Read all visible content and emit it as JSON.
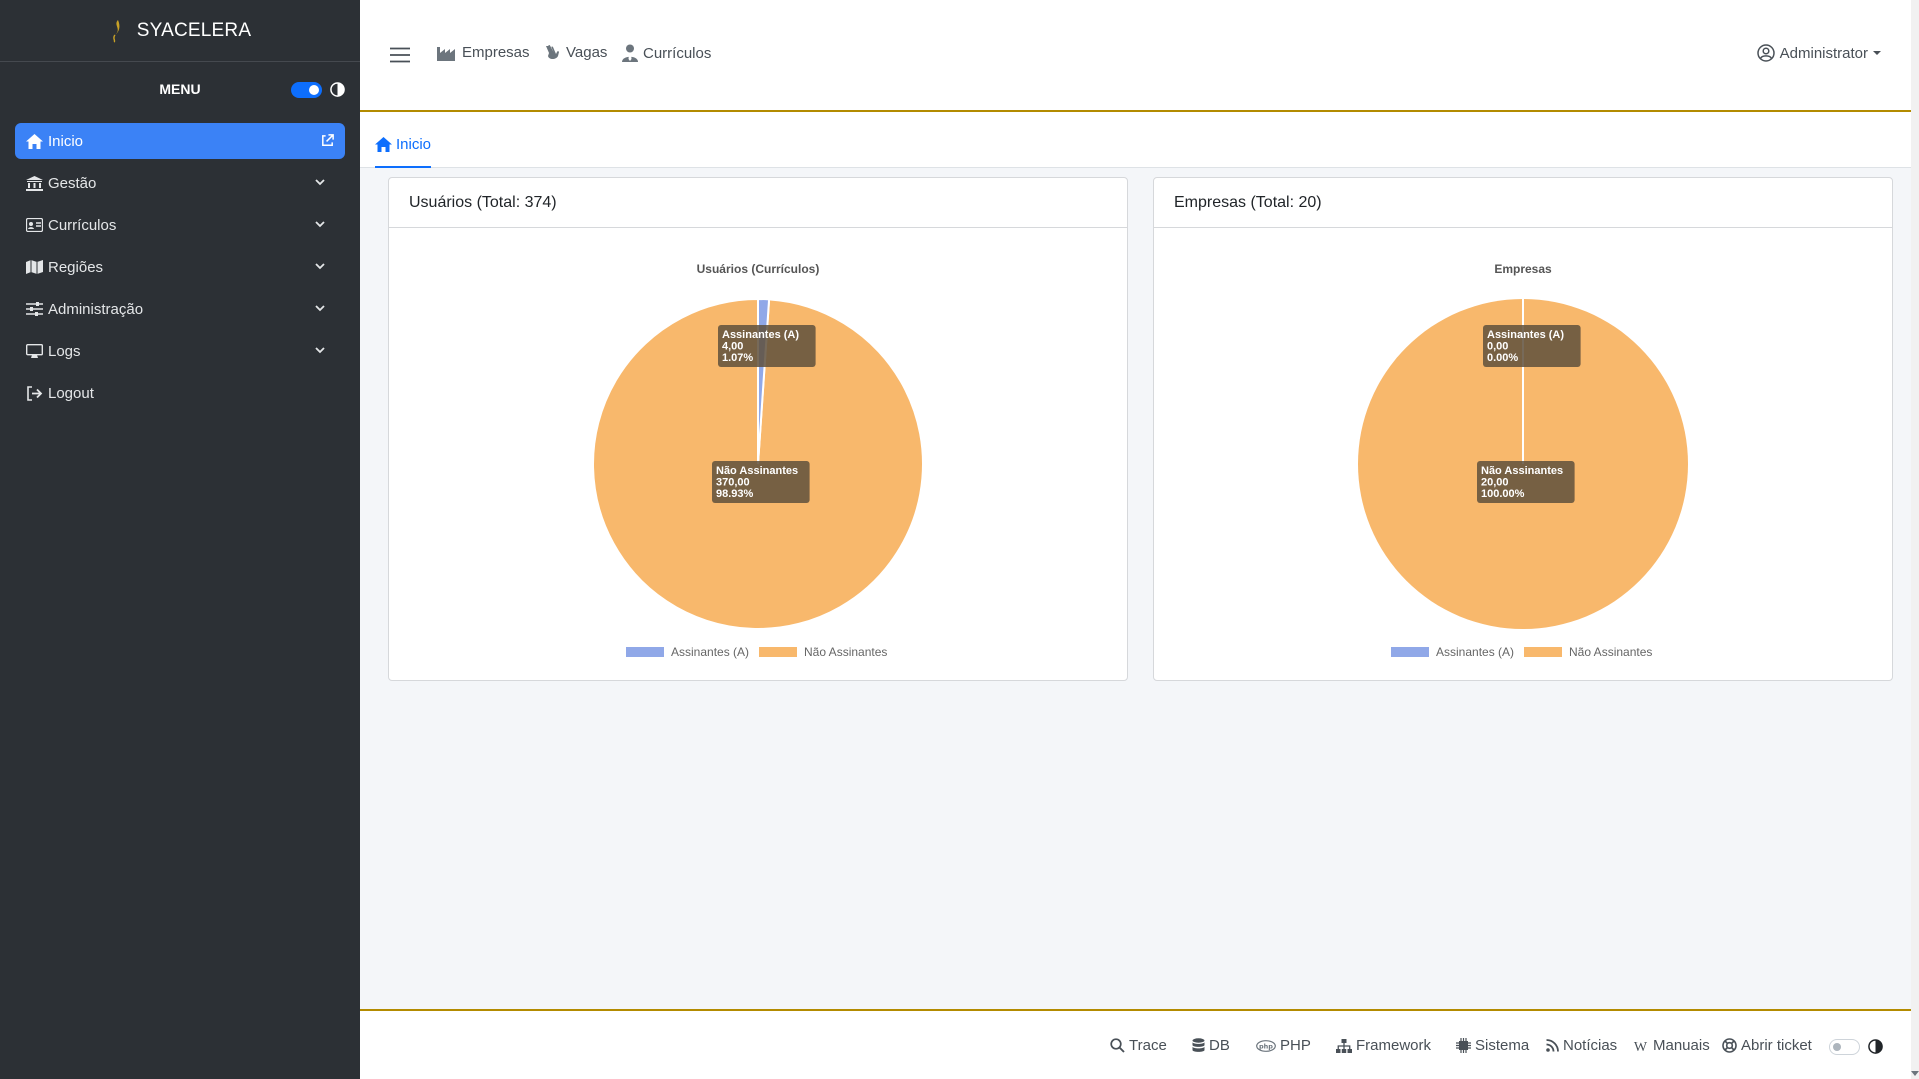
{
  "app": {
    "brand": "SYACELERA"
  },
  "sidebar": {
    "menu_label": "MENU",
    "items": [
      {
        "label": "Inicio",
        "icon": "home-icon",
        "active": true
      },
      {
        "label": "Gestão",
        "icon": "landmark-icon"
      },
      {
        "label": "Currículos",
        "icon": "id-card-icon"
      },
      {
        "label": "Regiões",
        "icon": "map-icon"
      },
      {
        "label": "Administração",
        "icon": "sliders-icon"
      },
      {
        "label": "Logs",
        "icon": "monitor-icon"
      },
      {
        "label": "Logout",
        "icon": "logout-icon"
      }
    ]
  },
  "topbar": {
    "links": [
      {
        "label": "Empresas",
        "icon": "industry-icon"
      },
      {
        "label": "Vagas",
        "icon": "hand-icon"
      },
      {
        "label": "Currículos",
        "icon": "user-tie-icon"
      }
    ],
    "user": "Administrator"
  },
  "tabs": [
    {
      "label": "Inicio",
      "icon": "home-icon"
    }
  ],
  "cards": [
    {
      "title": "Usuários (Total: 374)"
    },
    {
      "title": "Empresas (Total: 20)"
    }
  ],
  "chart_data": [
    {
      "type": "pie",
      "title": "Usuários (Currículos)",
      "categories": [
        "Assinantes (A)",
        "Não Assinantes"
      ],
      "values": [
        4,
        370
      ],
      "value_labels": [
        "4,00",
        "370,00"
      ],
      "percent_labels": [
        "1.07%",
        "98.93%"
      ],
      "colors": [
        "#90a8e8",
        "#f8b86c"
      ],
      "legend": "bottom"
    },
    {
      "type": "pie",
      "title": "Empresas",
      "categories": [
        "Assinantes (A)",
        "Não Assinantes"
      ],
      "values": [
        0,
        20
      ],
      "value_labels": [
        "0,00",
        "20,00"
      ],
      "percent_labels": [
        "0.00%",
        "100.00%"
      ],
      "colors": [
        "#90a8e8",
        "#f8b86c"
      ],
      "legend": "bottom"
    }
  ],
  "footer": {
    "links": [
      {
        "label": "Trace",
        "icon": "search-icon"
      },
      {
        "label": "DB",
        "icon": "database-icon"
      },
      {
        "label": "PHP",
        "icon": "php-icon"
      },
      {
        "label": "Framework",
        "icon": "sitemap-icon"
      },
      {
        "label": "Sistema",
        "icon": "cpu-icon"
      },
      {
        "label": "Notícias",
        "icon": "rss-icon"
      },
      {
        "label": "Manuais",
        "icon": "wikipedia-icon"
      },
      {
        "label": "Abrir ticket",
        "icon": "lifebuoy-icon"
      }
    ]
  }
}
